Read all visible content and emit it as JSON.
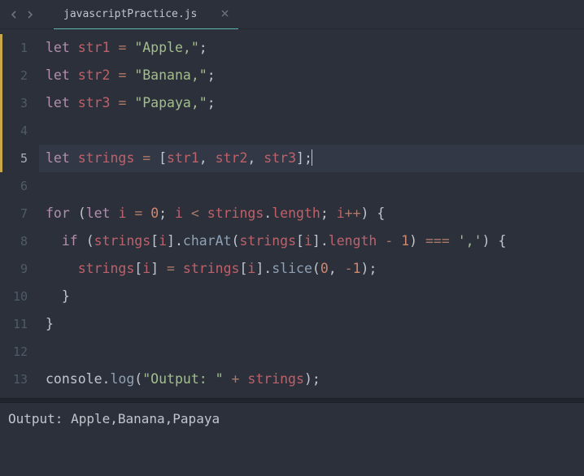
{
  "tabs": {
    "active": {
      "title": "javascriptPractice.js"
    }
  },
  "editor": {
    "activeLine": 5,
    "modifiedRange": {
      "start": 1,
      "end": 5
    },
    "lines": [
      {
        "n": 1,
        "tokens": [
          [
            "kw",
            "let"
          ],
          [
            "",
            ""
          ],
          [
            "varR",
            "str1"
          ],
          [
            "",
            ""
          ],
          [
            "op",
            "="
          ],
          [
            "",
            ""
          ],
          [
            "str",
            "\"Apple,\""
          ],
          [
            "punc",
            ";"
          ]
        ]
      },
      {
        "n": 2,
        "tokens": [
          [
            "kw",
            "let"
          ],
          [
            "",
            ""
          ],
          [
            "varR",
            "str2"
          ],
          [
            "",
            ""
          ],
          [
            "op",
            "="
          ],
          [
            "",
            ""
          ],
          [
            "str",
            "\"Banana,\""
          ],
          [
            "punc",
            ";"
          ]
        ]
      },
      {
        "n": 3,
        "tokens": [
          [
            "kw",
            "let"
          ],
          [
            "",
            ""
          ],
          [
            "varR",
            "str3"
          ],
          [
            "",
            ""
          ],
          [
            "op",
            "="
          ],
          [
            "",
            ""
          ],
          [
            "str",
            "\"Papaya,\""
          ],
          [
            "punc",
            ";"
          ]
        ]
      },
      {
        "n": 4,
        "tokens": []
      },
      {
        "n": 5,
        "tokens": [
          [
            "kw",
            "let"
          ],
          [
            "",
            ""
          ],
          [
            "varR",
            "strings"
          ],
          [
            "",
            ""
          ],
          [
            "op",
            "="
          ],
          [
            "",
            ""
          ],
          [
            "punc",
            "["
          ],
          [
            "varR",
            "str1"
          ],
          [
            "punc",
            ","
          ],
          [
            "",
            ""
          ],
          [
            "varR",
            "str2"
          ],
          [
            "punc",
            ","
          ],
          [
            "",
            ""
          ],
          [
            "varR",
            "str3"
          ],
          [
            "punc",
            "];"
          ]
        ]
      },
      {
        "n": 6,
        "tokens": []
      },
      {
        "n": 7,
        "tokens": [
          [
            "kw",
            "for"
          ],
          [
            "",
            ""
          ],
          [
            "punc",
            "("
          ],
          [
            "kw",
            "let"
          ],
          [
            "",
            ""
          ],
          [
            "varR",
            "i"
          ],
          [
            "",
            ""
          ],
          [
            "op",
            "="
          ],
          [
            "",
            ""
          ],
          [
            "num",
            "0"
          ],
          [
            "punc",
            ";"
          ],
          [
            "",
            ""
          ],
          [
            "varR",
            "i"
          ],
          [
            "",
            ""
          ],
          [
            "op",
            "<"
          ],
          [
            "",
            ""
          ],
          [
            "varR",
            "strings"
          ],
          [
            "punc",
            "."
          ],
          [
            "prop",
            "length"
          ],
          [
            "punc",
            ";"
          ],
          [
            "",
            ""
          ],
          [
            "varR",
            "i"
          ],
          [
            "op",
            "++"
          ],
          [
            "punc",
            ")"
          ],
          [
            "",
            ""
          ],
          [
            "punc",
            "{"
          ]
        ]
      },
      {
        "n": 8,
        "tokens": [
          [
            "",
            "  "
          ],
          [
            "kw",
            "if"
          ],
          [
            "",
            ""
          ],
          [
            "punc",
            "("
          ],
          [
            "varR",
            "strings"
          ],
          [
            "punc",
            "["
          ],
          [
            "varR",
            "i"
          ],
          [
            "punc",
            "]."
          ],
          [
            "mtd",
            "charAt"
          ],
          [
            "punc",
            "("
          ],
          [
            "varR",
            "strings"
          ],
          [
            "punc",
            "["
          ],
          [
            "varR",
            "i"
          ],
          [
            "punc",
            "]."
          ],
          [
            "prop",
            "length"
          ],
          [
            "",
            ""
          ],
          [
            "op",
            "-"
          ],
          [
            "",
            ""
          ],
          [
            "num",
            "1"
          ],
          [
            "punc",
            ")"
          ],
          [
            "",
            ""
          ],
          [
            "op",
            "==="
          ],
          [
            "",
            ""
          ],
          [
            "str",
            "','"
          ],
          [
            "punc",
            ")"
          ],
          [
            "",
            ""
          ],
          [
            "punc",
            "{"
          ]
        ]
      },
      {
        "n": 9,
        "tokens": [
          [
            "",
            "    "
          ],
          [
            "varR",
            "strings"
          ],
          [
            "punc",
            "["
          ],
          [
            "varR",
            "i"
          ],
          [
            "punc",
            "]"
          ],
          [
            "",
            ""
          ],
          [
            "op",
            "="
          ],
          [
            "",
            ""
          ],
          [
            "varR",
            "strings"
          ],
          [
            "punc",
            "["
          ],
          [
            "varR",
            "i"
          ],
          [
            "punc",
            "]."
          ],
          [
            "mtd",
            "slice"
          ],
          [
            "punc",
            "("
          ],
          [
            "num",
            "0"
          ],
          [
            "punc",
            ","
          ],
          [
            "",
            ""
          ],
          [
            "op",
            "-"
          ],
          [
            "num",
            "1"
          ],
          [
            "punc",
            ");"
          ]
        ]
      },
      {
        "n": 10,
        "tokens": [
          [
            "",
            "  "
          ],
          [
            "punc",
            "}"
          ]
        ]
      },
      {
        "n": 11,
        "tokens": [
          [
            "punc",
            "}"
          ]
        ]
      },
      {
        "n": 12,
        "tokens": []
      },
      {
        "n": 13,
        "tokens": [
          [
            "fn",
            "console"
          ],
          [
            "punc",
            "."
          ],
          [
            "mtd",
            "log"
          ],
          [
            "punc",
            "("
          ],
          [
            "str",
            "\"Output: \""
          ],
          [
            "",
            ""
          ],
          [
            "op",
            "+"
          ],
          [
            "",
            ""
          ],
          [
            "varR",
            "strings"
          ],
          [
            "punc",
            ");"
          ]
        ]
      }
    ]
  },
  "console": {
    "output": "Output: Apple,Banana,Papaya"
  }
}
